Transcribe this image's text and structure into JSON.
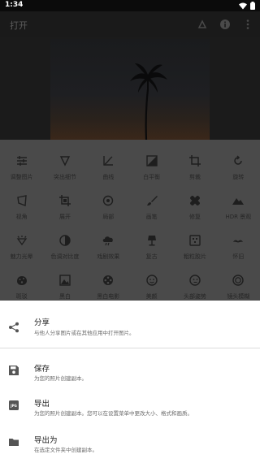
{
  "status_bar": {
    "time": "1:34"
  },
  "app_bar": {
    "title": "打开"
  },
  "tools": [
    {
      "label": "调整图片",
      "icon": "tune-icon"
    },
    {
      "label": "突出细节",
      "icon": "details-icon"
    },
    {
      "label": "曲线",
      "icon": "curves-icon"
    },
    {
      "label": "白平衡",
      "icon": "white-balance-icon"
    },
    {
      "label": "剪裁",
      "icon": "crop-icon"
    },
    {
      "label": "旋转",
      "icon": "rotate-icon"
    },
    {
      "label": "视角",
      "icon": "perspective-icon"
    },
    {
      "label": "展开",
      "icon": "expand-icon"
    },
    {
      "label": "局部",
      "icon": "selective-icon"
    },
    {
      "label": "画笔",
      "icon": "brush-icon"
    },
    {
      "label": "修复",
      "icon": "healing-icon"
    },
    {
      "label": "HDR 景观",
      "icon": "hdr-icon"
    },
    {
      "label": "魅力光晕",
      "icon": "glamour-glow-icon"
    },
    {
      "label": "色调对比度",
      "icon": "tonal-contrast-icon"
    },
    {
      "label": "戏剧效果",
      "icon": "drama-icon"
    },
    {
      "label": "复古",
      "icon": "vintage-icon"
    },
    {
      "label": "粗粒胶片",
      "icon": "grainy-film-icon"
    },
    {
      "label": "怀旧",
      "icon": "retrolux-icon"
    },
    {
      "label": "斑驳",
      "icon": "grunge-icon"
    },
    {
      "label": "黑白",
      "icon": "black-white-icon"
    },
    {
      "label": "黑白电影",
      "icon": "noir-icon"
    },
    {
      "label": "美颜",
      "icon": "face-icon"
    },
    {
      "label": "头部姿势",
      "icon": "head-pose-icon"
    },
    {
      "label": "镜头模糊",
      "icon": "lens-blur-icon"
    }
  ],
  "sheet": {
    "share": {
      "title": "分享",
      "subtitle": "与他人分享图片或在其他应用中打开图片。"
    },
    "save": {
      "title": "保存",
      "subtitle": "为您的照片创建副本。"
    },
    "export": {
      "title": "导出",
      "subtitle": "为您的照片创建副本。您可以在设置菜单中更改大小、格式和画质。"
    },
    "export_as": {
      "title": "导出为",
      "subtitle": "在选定文件夹中创建副本。"
    }
  }
}
